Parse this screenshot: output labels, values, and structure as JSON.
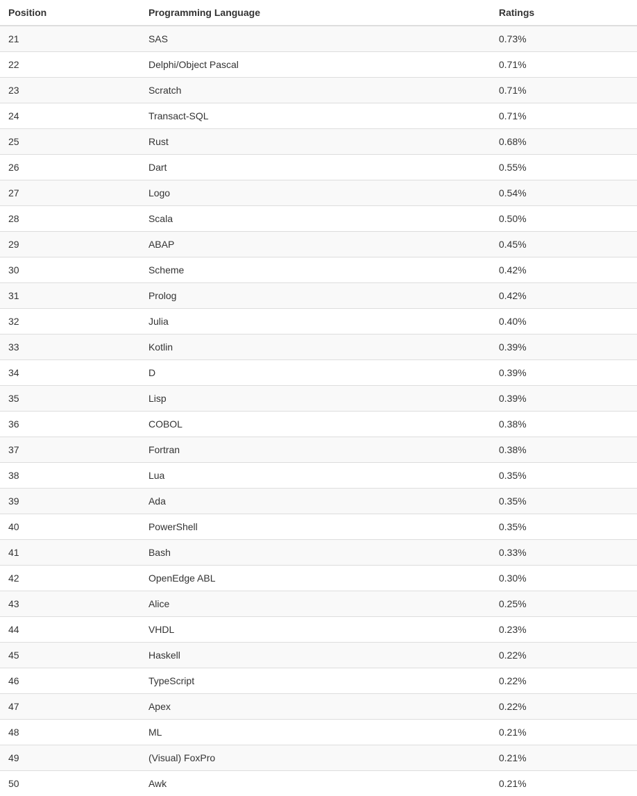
{
  "table": {
    "headers": {
      "position": "Position",
      "language": "Programming Language",
      "ratings": "Ratings"
    },
    "rows": [
      {
        "position": "21",
        "language": "SAS",
        "ratings": "0.73%"
      },
      {
        "position": "22",
        "language": "Delphi/Object Pascal",
        "ratings": "0.71%"
      },
      {
        "position": "23",
        "language": "Scratch",
        "ratings": "0.71%"
      },
      {
        "position": "24",
        "language": "Transact-SQL",
        "ratings": "0.71%"
      },
      {
        "position": "25",
        "language": "Rust",
        "ratings": "0.68%"
      },
      {
        "position": "26",
        "language": "Dart",
        "ratings": "0.55%"
      },
      {
        "position": "27",
        "language": "Logo",
        "ratings": "0.54%"
      },
      {
        "position": "28",
        "language": "Scala",
        "ratings": "0.50%"
      },
      {
        "position": "29",
        "language": "ABAP",
        "ratings": "0.45%"
      },
      {
        "position": "30",
        "language": "Scheme",
        "ratings": "0.42%"
      },
      {
        "position": "31",
        "language": "Prolog",
        "ratings": "0.42%"
      },
      {
        "position": "32",
        "language": "Julia",
        "ratings": "0.40%"
      },
      {
        "position": "33",
        "language": "Kotlin",
        "ratings": "0.39%"
      },
      {
        "position": "34",
        "language": "D",
        "ratings": "0.39%"
      },
      {
        "position": "35",
        "language": "Lisp",
        "ratings": "0.39%"
      },
      {
        "position": "36",
        "language": "COBOL",
        "ratings": "0.38%"
      },
      {
        "position": "37",
        "language": "Fortran",
        "ratings": "0.38%"
      },
      {
        "position": "38",
        "language": "Lua",
        "ratings": "0.35%"
      },
      {
        "position": "39",
        "language": "Ada",
        "ratings": "0.35%"
      },
      {
        "position": "40",
        "language": "PowerShell",
        "ratings": "0.35%"
      },
      {
        "position": "41",
        "language": "Bash",
        "ratings": "0.33%"
      },
      {
        "position": "42",
        "language": "OpenEdge ABL",
        "ratings": "0.30%"
      },
      {
        "position": "43",
        "language": "Alice",
        "ratings": "0.25%"
      },
      {
        "position": "44",
        "language": "VHDL",
        "ratings": "0.23%"
      },
      {
        "position": "45",
        "language": "Haskell",
        "ratings": "0.22%"
      },
      {
        "position": "46",
        "language": "TypeScript",
        "ratings": "0.22%"
      },
      {
        "position": "47",
        "language": "Apex",
        "ratings": "0.22%"
      },
      {
        "position": "48",
        "language": "ML",
        "ratings": "0.21%"
      },
      {
        "position": "49",
        "language": "(Visual) FoxPro",
        "ratings": "0.21%"
      },
      {
        "position": "50",
        "language": "Awk",
        "ratings": "0.21%"
      }
    ]
  }
}
